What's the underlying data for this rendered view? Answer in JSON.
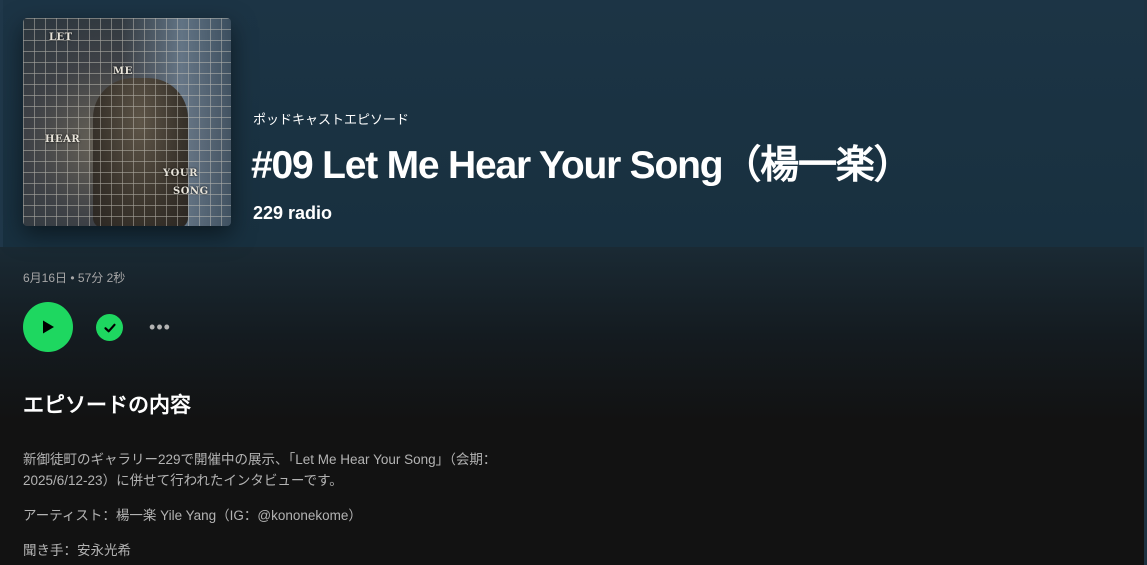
{
  "episode": {
    "type_label": "ポッドキャストエピソード",
    "title": "#09 Let Me Hear Your Song（楊一楽）",
    "show_name": "229 radio",
    "meta": "6月16日 • 57分 2秒"
  },
  "cover": {
    "words": [
      "LET",
      "ME",
      "HEAR",
      "YOUR",
      "SONG"
    ]
  },
  "controls": {
    "more_label": "•••"
  },
  "description": {
    "heading": "エピソードの内容",
    "paragraph1_line1": "新御徒町のギャラリー229で開催中の展示、「Let Me Hear Your Song」（会期：",
    "paragraph1_line2": "2025/6/12-23）に併せて行われたインタビューです。",
    "paragraph2": "アーティスト：楊一楽 Yile Yang（IG：@kononekome）",
    "paragraph3": "聞き手：安永光希"
  },
  "colors": {
    "accent": "#1ed760",
    "header_bg": "#1c3445",
    "page_bg": "#121212",
    "muted_text": "#b3b3b3"
  },
  "icons": {
    "play": "play-icon",
    "saved": "check-circle-icon",
    "more": "more-options-icon"
  }
}
